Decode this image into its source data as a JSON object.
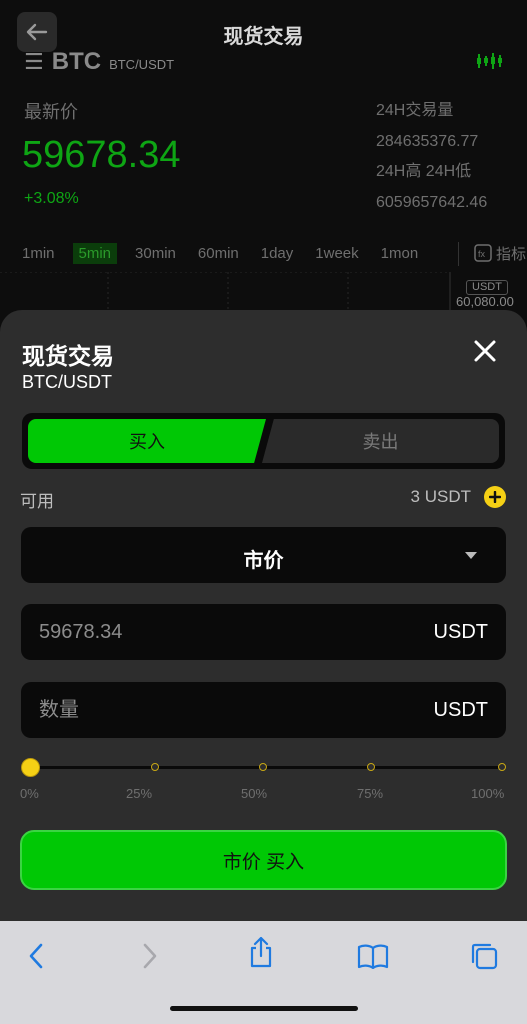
{
  "background": {
    "title": "现货交易",
    "pair_symbol": "BTC",
    "pair_name": "BTC/USDT",
    "latest_label": "最新价",
    "latest_price": "59678.34",
    "change": "+3.08%",
    "volume_label": "24H交易量",
    "volume_value": "284635376.77",
    "highlow_label": "24H高 24H低",
    "highlow_value": "6059657642.46",
    "intervals": [
      "1min",
      "5min",
      "30min",
      "60min",
      "1day",
      "1week",
      "1mon"
    ],
    "active_interval": "5min",
    "indicator_label": "指标",
    "price_tag": "USDT",
    "price_axis_value": "60,080.00"
  },
  "sheet": {
    "title": "现货交易",
    "pair": "BTC/USDT",
    "buy_label": "买入",
    "sell_label": "卖出",
    "available_label": "可用",
    "available_value": "3 USDT",
    "order_type": "市价",
    "price_value": "59678.34",
    "price_unit": "USDT",
    "quantity_placeholder": "数量",
    "quantity_unit": "USDT",
    "slider_fraction": 0,
    "percent_marks": [
      "0%",
      "25%",
      "50%",
      "75%",
      "100%"
    ],
    "submit_label": "市价 买入"
  },
  "colors": {
    "accent_green": "#00c805",
    "price_green": "#0ea514",
    "slider_yellow": "#f5d015"
  },
  "icons": [
    "back-arrow-icon",
    "menu-icon",
    "candlestick-icon",
    "indicator-icon",
    "close-icon",
    "plus-circle-icon",
    "caret-down-icon",
    "chevron-left-icon",
    "chevron-right-icon",
    "share-icon",
    "bookmarks-icon",
    "tabs-icon"
  ]
}
